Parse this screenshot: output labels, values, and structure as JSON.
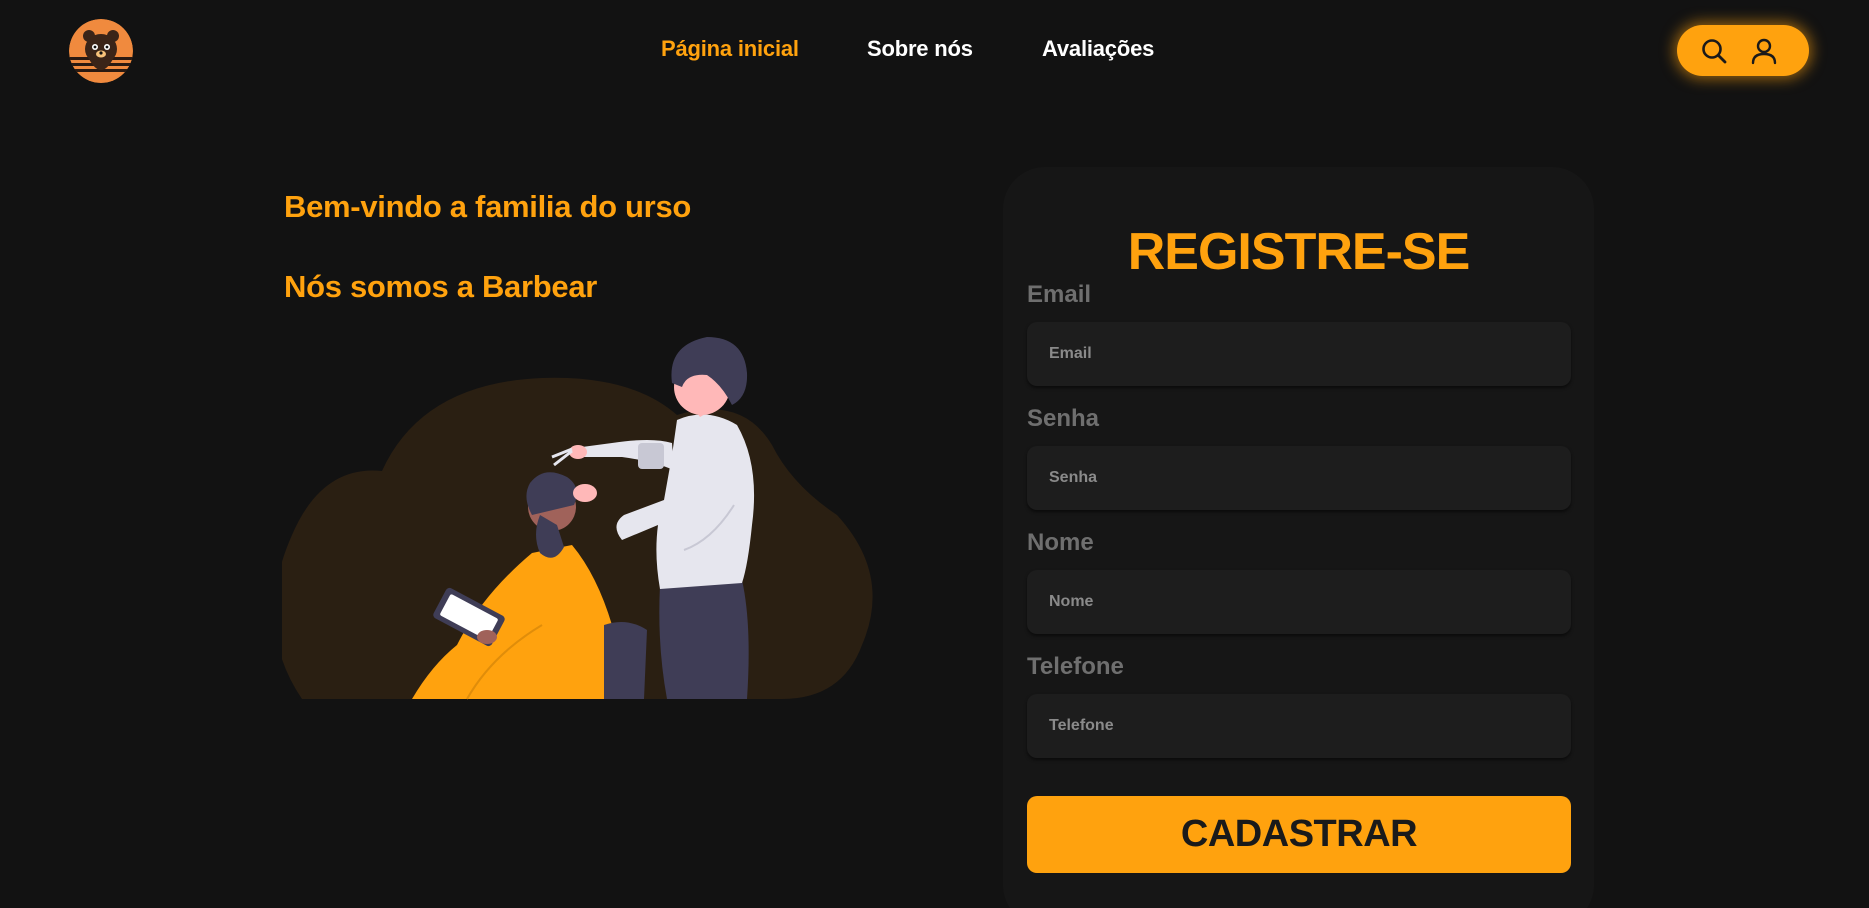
{
  "header": {
    "logo_icon": "bear-logo-icon",
    "nav": [
      {
        "label": "Página inicial",
        "active": true
      },
      {
        "label": "Sobre nós",
        "active": false
      },
      {
        "label": "Avaliações",
        "active": false
      }
    ],
    "actions": {
      "search_icon": "search-icon",
      "user_icon": "user-icon"
    }
  },
  "hero": {
    "line1": "Bem-vindo a familia do urso",
    "line2": "Nós somos a Barbear"
  },
  "register": {
    "title": "REGISTRE-SE",
    "fields": [
      {
        "label": "Email",
        "placeholder": "Email",
        "value": ""
      },
      {
        "label": "Senha",
        "placeholder": "Senha",
        "value": ""
      },
      {
        "label": "Nome",
        "placeholder": "Nome",
        "value": ""
      },
      {
        "label": "Telefone",
        "placeholder": "Telefone",
        "value": ""
      }
    ],
    "submit_label": "CADASTRAR"
  },
  "colors": {
    "accent": "#ffa20e",
    "background": "#121212",
    "card": "#161616",
    "input": "#1d1d1d"
  }
}
